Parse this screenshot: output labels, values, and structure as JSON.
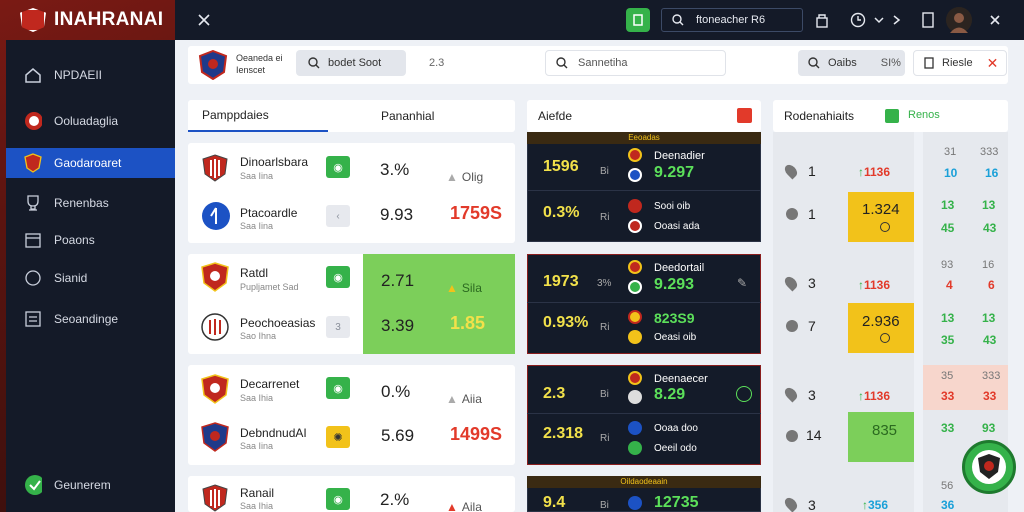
{
  "app": {
    "title": "INAHRANAI"
  },
  "sidebar": {
    "items": [
      {
        "label": "NPDAEII"
      },
      {
        "label": "Ooluadaglia"
      },
      {
        "label": "Gaodaroaret"
      },
      {
        "label": "Renenbas"
      },
      {
        "label": "Poaons"
      },
      {
        "label": "Sianid"
      },
      {
        "label": "Seoandinge"
      }
    ],
    "footer_label": "Geunerem"
  },
  "topbar": {
    "search_text": "ftoneacher R6"
  },
  "header": {
    "brand_line1": "Oeaneda ei",
    "brand_line2": "Ienscet",
    "pill_label": "bodet Soot",
    "pill_value": "2.3",
    "search_placeholder": "Sannetiha",
    "filter_label": "Oaibs",
    "filter_value": "SI%",
    "reset_label": "Riesle"
  },
  "tabs": {
    "left": "Pamppdaies",
    "right": "Pananhial",
    "middle": "Aiefde",
    "right_panel": "Rodenahiaits",
    "right_badge": "Renos"
  },
  "matches": [
    {
      "home": "Dinoarlsbara",
      "home_sub": "Saa Iina",
      "away": "Ptacoardle",
      "away_sub": "Saa Iina",
      "line1": "3.%",
      "line1b": "Olig",
      "line2": "9.93",
      "odd": "1759S",
      "odd_color": "#e23a2a"
    },
    {
      "home": "Ratdl",
      "home_sub": "Pupljamet Sad",
      "away": "Peochoeasias",
      "away_sub": "Sao Ihna",
      "line1": "2.71",
      "line1b": "Sila",
      "line2": "3.39",
      "odd": "1.85",
      "odd_color": "#f2e14a"
    },
    {
      "home": "Decarrenet",
      "home_sub": "Saa Ihia",
      "away": "DebndnudAI",
      "away_sub": "Saa Iina",
      "line1": "0.%",
      "line1b": "Aiia",
      "line2": "5.69",
      "odd": "1499S",
      "odd_color": "#e23a2a"
    },
    {
      "home": "Ranail",
      "home_sub": "Saa Ihia",
      "away": "",
      "away_sub": "",
      "line1": "2.%",
      "line1b": "Aila",
      "line2": "",
      "odd": "",
      "odd_color": "#e23a2a"
    }
  ],
  "live": [
    {
      "header": "Eeoadas",
      "left1": "1596",
      "left1s": "Bi",
      "left2": "0.3%",
      "left2s": "Ri",
      "name1": "Deenadier",
      "val1": "9.297",
      "name2": "Sooi oib",
      "name3": "Ooasi ada"
    },
    {
      "header": "",
      "left1": "1973",
      "left1s": "3%",
      "left2": "0.93%",
      "left2s": "Ri",
      "name1": "Deedortail",
      "val1": "9.293",
      "name2": "",
      "val2": "823S9",
      "name3": "Oeasi oib"
    },
    {
      "header": "",
      "left1": "2.3",
      "left1s": "Bi",
      "left2": "2.318",
      "left2s": "Ri",
      "name1": "Deenaecer",
      "val1": "8.29",
      "name2": "Ooaa doo",
      "name3": "Oeeil odo"
    },
    {
      "header": "Oildaodeaain",
      "left1": "9.4",
      "left1s": "Bi",
      "left2": "",
      "left2s": "",
      "name1": "",
      "val1": "12735",
      "name2": "",
      "name3": ""
    }
  ],
  "stats": [
    {
      "a": "1",
      "red": "1136",
      "yellow": "",
      "c1": "31",
      "c2": "333",
      "c3": "10",
      "c4": "16"
    },
    {
      "a": "1",
      "red": "",
      "yellow": "1.324",
      "c1": "13",
      "c2": "13",
      "c3": "45",
      "c4": "43"
    },
    {
      "a": "3",
      "red": "1136",
      "yellow": "",
      "c1": "93",
      "c2": "16",
      "c3": "4",
      "c4": "6"
    },
    {
      "a": "7",
      "red": "",
      "yellow": "2.936",
      "c1": "13",
      "c2": "13",
      "c3": "35",
      "c4": "43"
    },
    {
      "a": "3",
      "red": "1136",
      "yellow": "",
      "c1": "35",
      "c2": "333",
      "c3": "33",
      "c4": "33"
    },
    {
      "a": "14",
      "red": "",
      "yellow": "835",
      "c1": "33",
      "c2": "93",
      "c3": "",
      "c4": ""
    },
    {
      "a": "3",
      "red": "356",
      "yellow": "",
      "c1": "56",
      "c2": "36",
      "c3": "",
      "c4": ""
    }
  ],
  "colors": {
    "accent": "#1c52c4",
    "green": "#35b24a",
    "yellow": "#f2c21a",
    "red": "#e23a2a",
    "dark": "#141b29"
  }
}
